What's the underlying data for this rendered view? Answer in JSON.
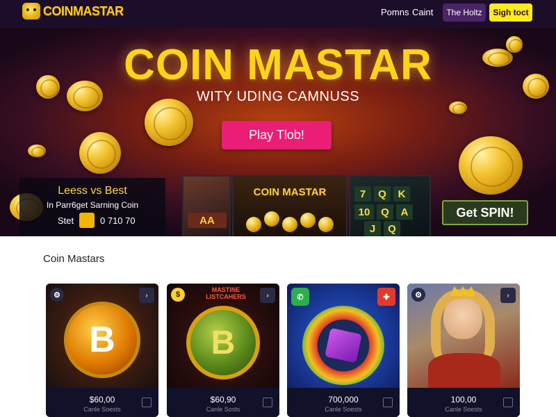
{
  "brand": {
    "name": "COINMASTAR"
  },
  "nav": {
    "link_1": "Pomns",
    "link_2": "Caint",
    "button_1": "The Holtz",
    "button_2": "Sigh toct"
  },
  "hero": {
    "title": "COIN MASTAR",
    "subtitle": "WITY UDING CAMNUSS",
    "play_button": "Play Tlob!",
    "panel": {
      "line_1": "Leess vs Best",
      "line_2": "In Parr6get Sarning Coin",
      "label": "Stet",
      "value": "0 710 70"
    },
    "screen_title": "COIN MASTAR",
    "spin_button": "Get SPIN!"
  },
  "section": {
    "title": "Coin Mastars"
  },
  "cards": [
    {
      "price": "$60,00",
      "caption": "Canle Soests",
      "symbol": "B"
    },
    {
      "price": "$60,90",
      "caption": "Canle Sosts",
      "symbol": "B",
      "banner": "MASTINE LISTCAHERS"
    },
    {
      "price": "700,000",
      "caption": "Canle Soests",
      "symbol": ""
    },
    {
      "price": "100,00",
      "caption": "Canle Soests",
      "symbol": ""
    }
  ],
  "colors": {
    "nav_bg": "#1c0d2a",
    "accent_yellow": "#ffea1a",
    "play_pink": "#ea1e74",
    "gold": "#ffd31a"
  },
  "icons": {
    "share": "chevron-share-icon",
    "check": "checkbox-icon"
  }
}
